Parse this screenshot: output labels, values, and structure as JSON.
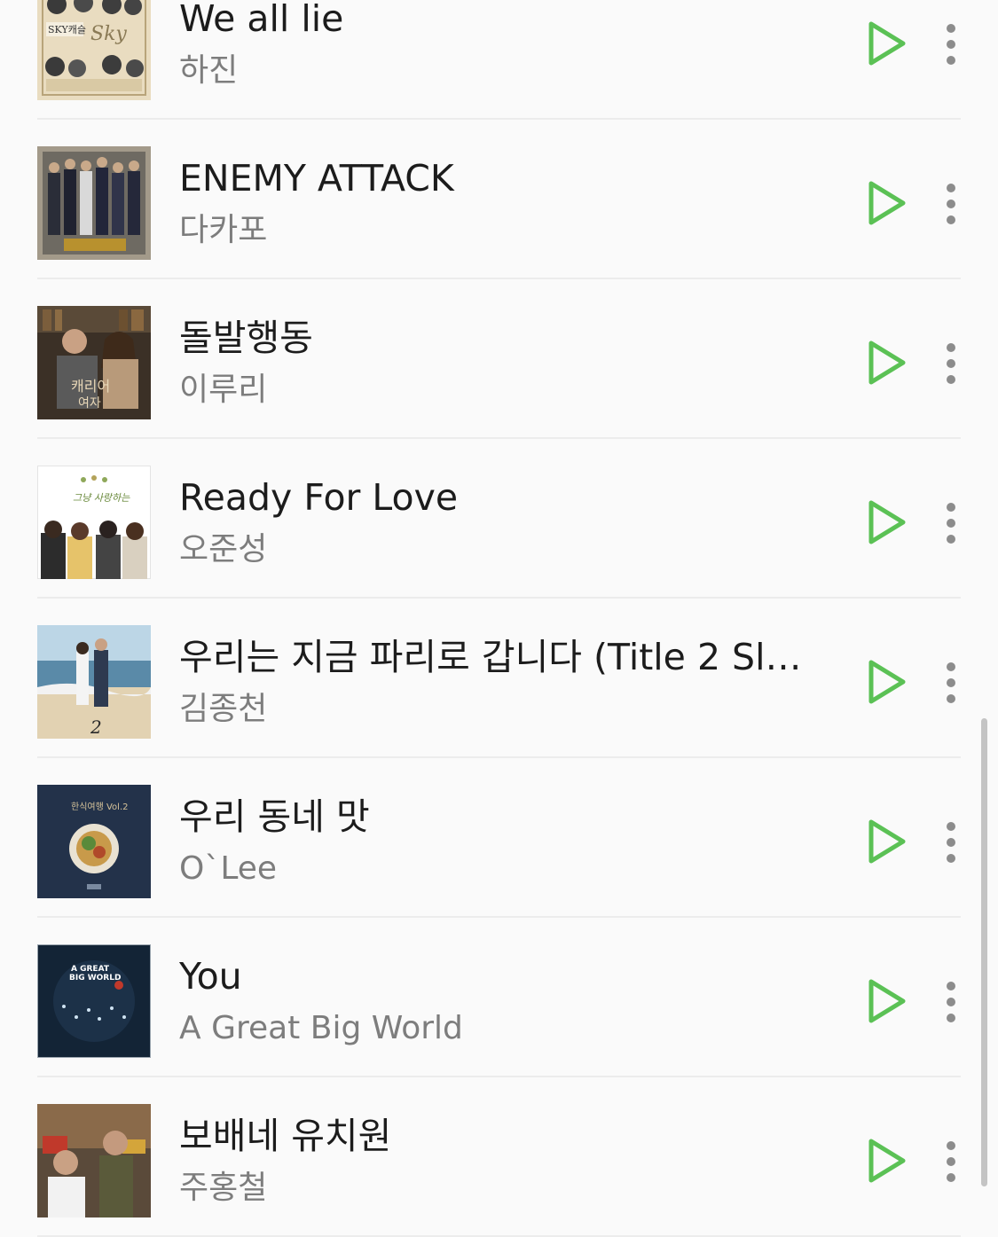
{
  "accent_color": "#5bc155",
  "songs": [
    {
      "title": "We all lie",
      "artist": "하진"
    },
    {
      "title": "ENEMY ATTACK",
      "artist": "다카포"
    },
    {
      "title": "돌발행동",
      "artist": "이루리"
    },
    {
      "title": "Ready For Love",
      "artist": "오준성"
    },
    {
      "title": "우리는 지금 파리로 갑니다 (Title 2 Sl…",
      "artist": "김종천"
    },
    {
      "title": "우리 동네 맛",
      "artist": "O`Lee"
    },
    {
      "title": "You",
      "artist": "A Great Big World"
    },
    {
      "title": "보배네 유치원",
      "artist": "주홍철"
    }
  ],
  "icons": {
    "play": "play-icon",
    "more": "more-vertical-icon"
  }
}
